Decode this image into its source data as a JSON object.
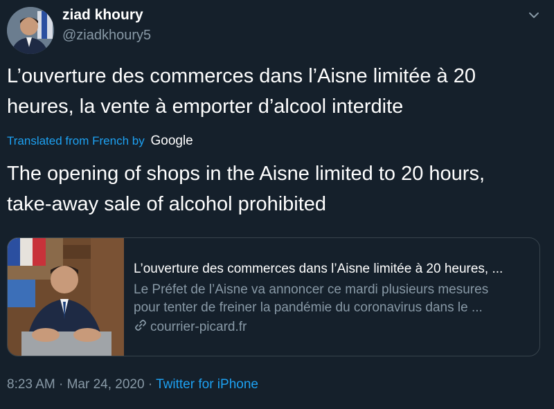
{
  "user": {
    "name": "ziad khoury",
    "handle": "@ziadkhoury5"
  },
  "tweet": {
    "text_line1": "L’ouverture des commerces dans l’Aisne limitée à 20",
    "text_line2": "heures, la vente à emporter d’alcool interdite"
  },
  "translation": {
    "label": "Translated from French by",
    "provider": "Google",
    "text_line1": "The opening of shops in the Aisne limited to 20 hours,",
    "text_line2": "take-away sale of alcohol prohibited"
  },
  "card": {
    "title": "L’ouverture des commerces dans l’Aisne limitée à 20 heures, ...",
    "desc_line1": "Le Préfet de l’Aisne va annoncer ce mardi plusieurs mesures",
    "desc_line2": "pour tenter de freiner la pandémie du coronavirus dans le ...",
    "domain": "courrier-picard.fr"
  },
  "meta": {
    "time": "8:23 AM",
    "date": "Mar 24, 2020",
    "source": "Twitter for iPhone"
  },
  "icons": {
    "chevron": "chevron-down-icon",
    "link": "link-icon"
  },
  "colors": {
    "background": "#15202b",
    "accent": "#1da1f2",
    "secondary_text": "#8899a6",
    "border": "#38444d"
  }
}
